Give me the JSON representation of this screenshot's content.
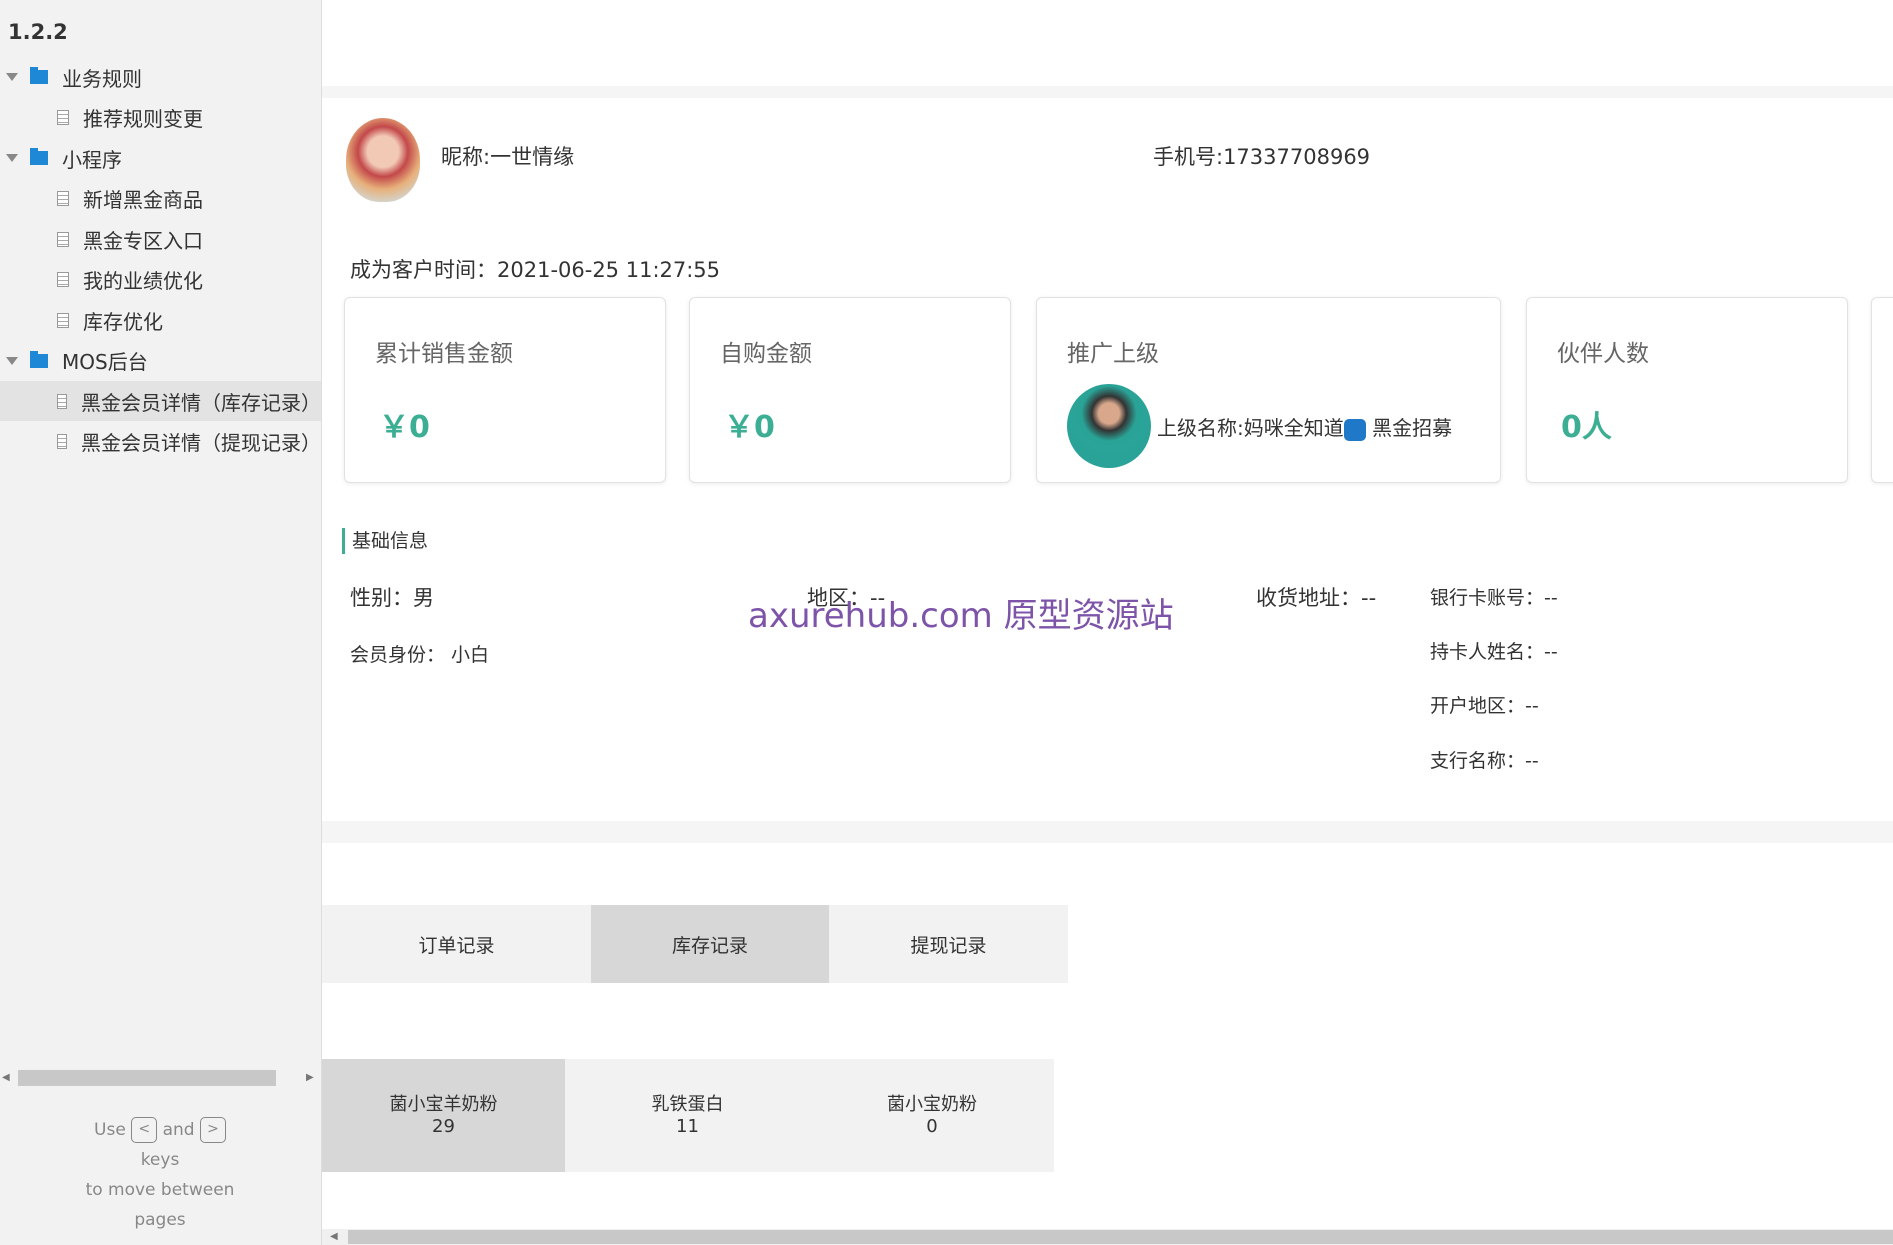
{
  "sidebar": {
    "version": "1.2.2",
    "items": [
      {
        "label": "业务规则",
        "type": "folder"
      },
      {
        "label": "推荐规则变更",
        "type": "page"
      },
      {
        "label": "小程序",
        "type": "folder"
      },
      {
        "label": "新增黑金商品",
        "type": "page"
      },
      {
        "label": "黑金专区入口",
        "type": "page"
      },
      {
        "label": "我的业绩优化",
        "type": "page"
      },
      {
        "label": "库存优化",
        "type": "page"
      },
      {
        "label": "MOS后台",
        "type": "folder"
      },
      {
        "label": "黑金会员详情（库存记录）",
        "type": "page",
        "selected": true
      },
      {
        "label": "黑金会员详情（提现记录）",
        "type": "page"
      }
    ],
    "help": {
      "use": "Use",
      "prev_key": "<",
      "and": "and",
      "next_key": ">",
      "keys": "keys",
      "line2": "to move between",
      "line3": "pages"
    }
  },
  "profile": {
    "nickname": "昵称:一世情缘",
    "phone": "手机号:17337708969",
    "customer_since": "成为客户时间：2021-06-25 11:27:55"
  },
  "stats": [
    {
      "label": "累计销售金额",
      "value": "￥0"
    },
    {
      "label": "自购金额",
      "value": "￥0"
    },
    {
      "label": "推广上级",
      "upline": "上级名称:妈咪全知道",
      "upline_suffix": "黑金招募"
    },
    {
      "label": "伙伴人数",
      "value": "0人"
    }
  ],
  "basic": {
    "title": "基础信息",
    "gender": "性别：男",
    "region": "地区：--",
    "address": "收货地址：--",
    "member": "会员身份： 小白",
    "bank_account": "银行卡账号：--",
    "card_holder": "持卡人姓名：--",
    "bank_region": "开户地区：--",
    "branch": "支行名称：--"
  },
  "watermark": "axurehub.com 原型资源站",
  "tabs": [
    {
      "label": "订单记录"
    },
    {
      "label": "库存记录",
      "active": true
    },
    {
      "label": "提现记录"
    }
  ],
  "products": [
    {
      "name": "菌小宝羊奶粉",
      "count": "29",
      "active": true
    },
    {
      "name": "乳铁蛋白",
      "count": "11"
    },
    {
      "name": "菌小宝奶粉",
      "count": "0"
    }
  ],
  "colors": {
    "accent": "#3cae94",
    "folder": "#1e88d6"
  }
}
